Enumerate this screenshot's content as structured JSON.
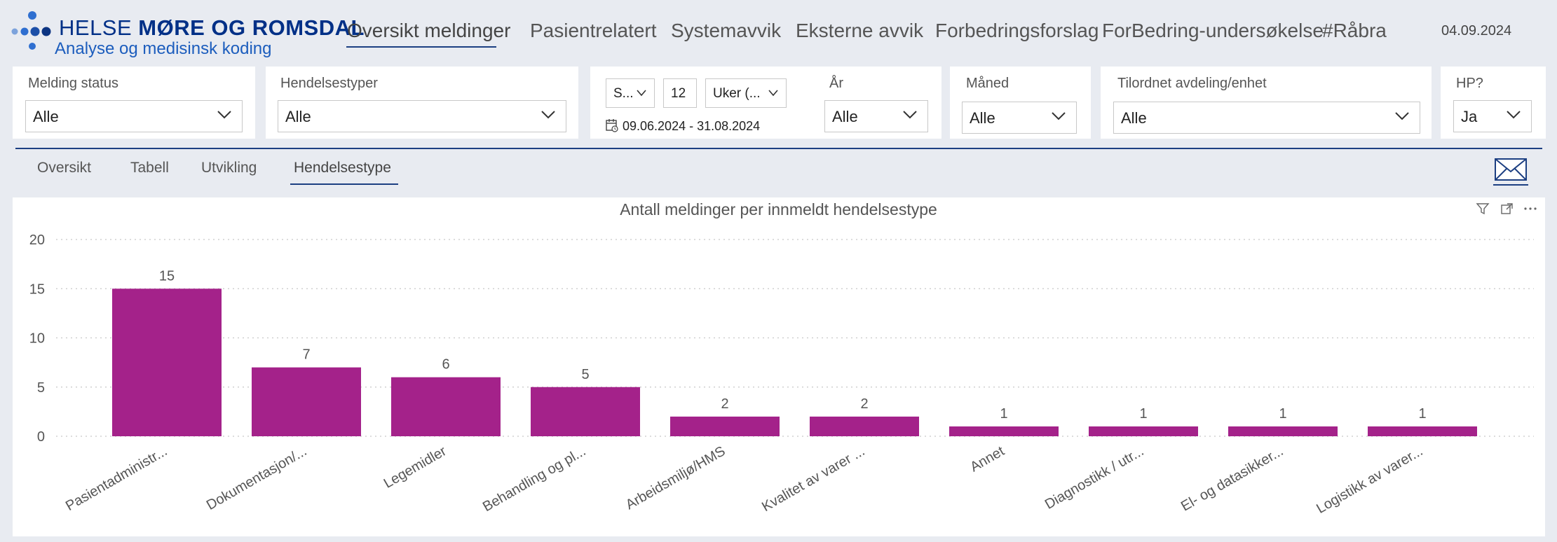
{
  "header": {
    "brand_title_a": "HELSE ",
    "brand_title_b": "MØRE OG ROMSDAL",
    "brand_subtitle": "Analyse og medisinsk koding",
    "date": "04.09.2024",
    "nav": [
      {
        "label": "Oversikt meldinger",
        "active": true
      },
      {
        "label": "Pasientrelatert"
      },
      {
        "label": "Systemavvik"
      },
      {
        "label": "Eksterne avvik"
      },
      {
        "label": "Forbedringsforslag"
      },
      {
        "label": "ForBedring-undersøkelse"
      },
      {
        "label": "#Råbra"
      }
    ]
  },
  "filters": {
    "melding_status": {
      "label": "Melding status",
      "value": "Alle"
    },
    "hendelsestyper": {
      "label": "Hendelsestyper",
      "value": "Alle"
    },
    "period": {
      "unit_short": "S...",
      "count": "12",
      "unit": "Uker (...",
      "range": "09.06.2024 - 31.08.2024"
    },
    "aar": {
      "label": "År",
      "value": "Alle"
    },
    "maaned": {
      "label": "Måned",
      "value": "Alle"
    },
    "avdeling": {
      "label": "Tilordnet avdeling/enhet",
      "value": "Alle"
    },
    "hp": {
      "label": "HP?",
      "value": "Ja"
    }
  },
  "tabs": [
    {
      "label": "Oversikt"
    },
    {
      "label": "Tabell"
    },
    {
      "label": "Utvikling"
    },
    {
      "label": "Hendelsestype",
      "active": true
    }
  ],
  "colors": {
    "bar": "#a4228a",
    "brand": "#003087",
    "accent": "#1c3f82",
    "logo_dots": "#2f6fd0"
  },
  "icons": [
    "logo-dots",
    "chevron-down-icon",
    "calendar-icon",
    "mail-icon",
    "filter-icon",
    "focus-mode-icon",
    "more-options-icon"
  ],
  "chart_data": {
    "type": "bar",
    "title": "Antall meldinger per innmeldt hendelsestype",
    "categories": [
      "Pasientadministr...",
      "Dokumentasjon/...",
      "Legemidler",
      "Behandling og pl...",
      "Arbeidsmiljø/HMS",
      "Kvalitet av varer ...",
      "Annet",
      "Diagnostikk / utr...",
      "El- og datasikker...",
      "Logistikk av varer..."
    ],
    "values": [
      15,
      7,
      6,
      5,
      2,
      2,
      1,
      1,
      1,
      1
    ],
    "ylim": [
      0,
      20
    ],
    "yticks": [
      0,
      5,
      10,
      15,
      20
    ],
    "grid": true,
    "data_labels": true
  }
}
